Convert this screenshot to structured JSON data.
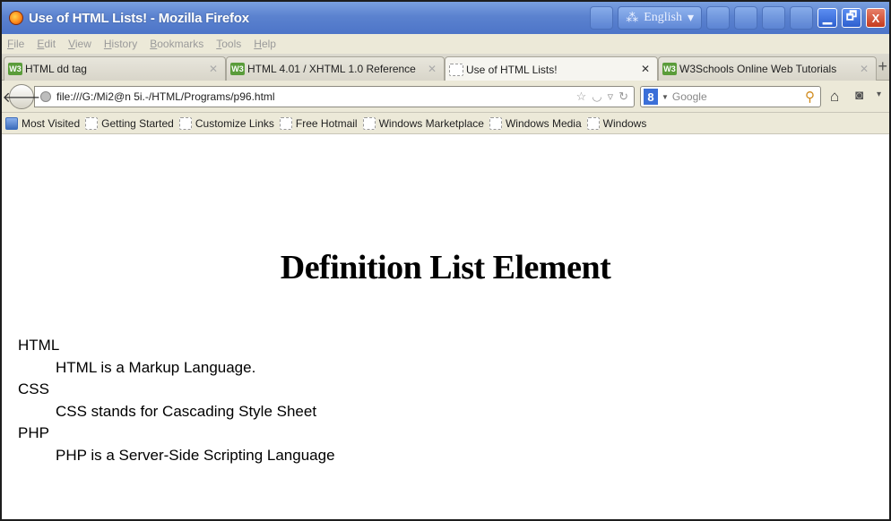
{
  "window": {
    "title": "Use of HTML Lists! - Mozilla Firefox",
    "language": "English",
    "buttons": {
      "minimize": "▁",
      "restore": "🗗",
      "close": "X"
    }
  },
  "menubar": [
    "File",
    "Edit",
    "View",
    "History",
    "Bookmarks",
    "Tools",
    "Help"
  ],
  "tabs": [
    {
      "label": "HTML dd tag",
      "favicon": "w3c",
      "active": false
    },
    {
      "label": "HTML 4.01 / XHTML 1.0 Reference",
      "favicon": "w3c",
      "active": false
    },
    {
      "label": "Use of HTML Lists!",
      "favicon": "blank",
      "active": true
    },
    {
      "label": "W3Schools Online Web Tutorials",
      "favicon": "w3c",
      "active": false
    }
  ],
  "navbar": {
    "url": "file:///G:/Mi2@n 5i.-/HTML/Programs/p96.html",
    "search_engine_icon": "8",
    "search_placeholder": "Google"
  },
  "bookmarks": [
    "Most Visited",
    "Getting Started",
    "Customize Links",
    "Free Hotmail",
    "Windows Marketplace",
    "Windows Media",
    "Windows"
  ],
  "content": {
    "heading": "Definition List Element",
    "definitions": [
      {
        "term": "HTML",
        "description": "HTML is a Markup Language."
      },
      {
        "term": "CSS",
        "description": "CSS stands for Cascading Style Sheet"
      },
      {
        "term": "PHP",
        "description": "PHP is a Server-Side Scripting Language"
      }
    ]
  }
}
